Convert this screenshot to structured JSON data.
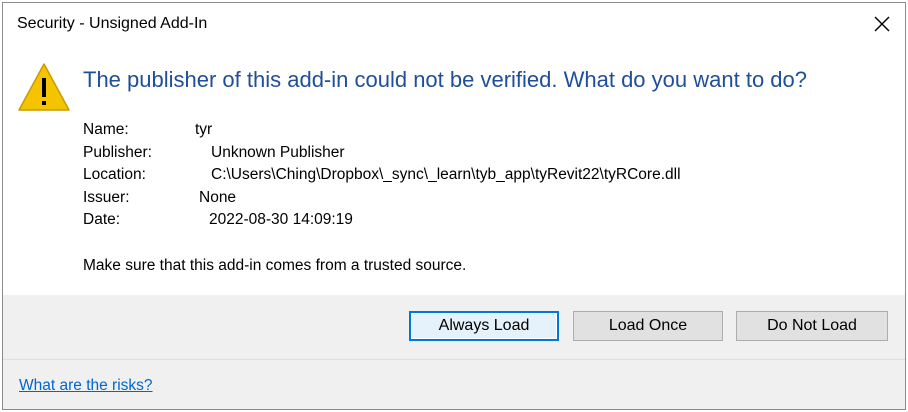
{
  "window": {
    "title": "Security - Unsigned Add-In",
    "close_glyph": "✕"
  },
  "warning_icon": {
    "icon": "warning-triangle-icon",
    "glyph": "!",
    "color": "#f5c400"
  },
  "main_instruction": "The publisher of this add-in could not be verified. What do you want to do?",
  "details": {
    "name_label": "Name:",
    "name_value": "tyr",
    "publisher_label": "Publisher:",
    "publisher_value": "Unknown Publisher",
    "location_label": "Location:",
    "location_value": "C:\\Users\\Ching\\Dropbox\\_sync\\_learn\\tyb_app\\tyRevit22\\tyRCore.dll",
    "issuer_label": "Issuer:",
    "issuer_value": "None",
    "date_label": "Date:",
    "date_value": "2022-08-30 14:09:19"
  },
  "trust_message": "Make sure that this add-in comes from a trusted source.",
  "buttons": {
    "always_load": "Always Load",
    "load_once": "Load Once",
    "do_not_load": "Do Not Load"
  },
  "footer": {
    "risks_link": "What are the risks?"
  },
  "colors": {
    "instruction_text": "#1f4e9a",
    "link": "#0066cc",
    "footer_bg": "#f0f0f0",
    "default_button_border": "#0078d7"
  }
}
